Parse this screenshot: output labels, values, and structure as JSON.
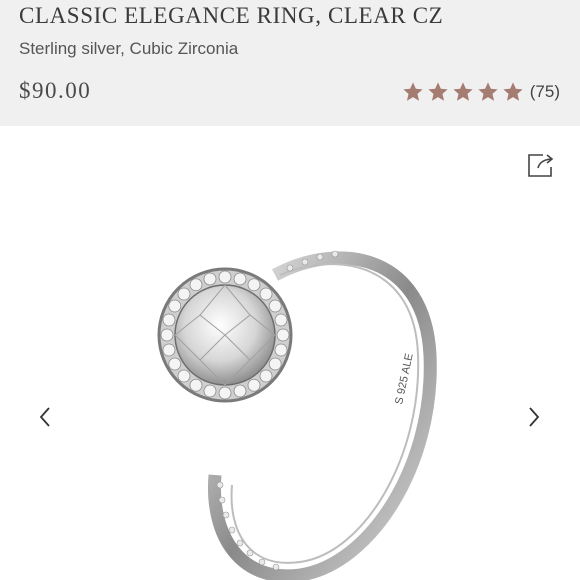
{
  "product": {
    "title": "CLASSIC ELEGANCE RING, CLEAR CZ",
    "subtitle": "Sterling silver, Cubic Zirconia",
    "price": "$90.00",
    "rating": {
      "stars": 5,
      "count": "(75)",
      "star_color": "#a47c72"
    }
  },
  "image": {
    "engraving": "S 925 ALE",
    "icons": [
      "share-icon",
      "chevron-left-icon",
      "chevron-right-icon"
    ]
  },
  "colors": {
    "header_bg": "#f0f0f0",
    "text": "#3a3a3a",
    "accent_star": "#a47c72"
  }
}
